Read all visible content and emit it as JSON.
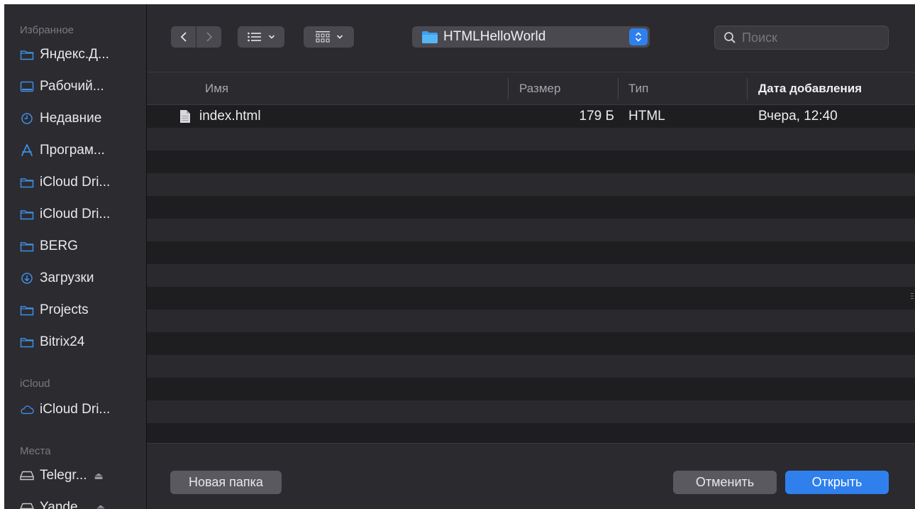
{
  "sidebar": {
    "favorites_title": "Избранное",
    "favorites": [
      {
        "label": "Яндекс.Д...",
        "icon": "folder-icon"
      },
      {
        "label": "Рабочий...",
        "icon": "desktop-icon"
      },
      {
        "label": "Недавние",
        "icon": "clock-icon"
      },
      {
        "label": "Програм...",
        "icon": "apps-icon"
      },
      {
        "label": "iCloud Dri...",
        "icon": "folder-icon"
      },
      {
        "label": "iCloud Dri...",
        "icon": "folder-icon"
      },
      {
        "label": "BERG",
        "icon": "folder-icon"
      },
      {
        "label": "Загрузки",
        "icon": "download-icon"
      },
      {
        "label": "Projects",
        "icon": "folder-icon"
      },
      {
        "label": "Bitrix24",
        "icon": "folder-icon"
      }
    ],
    "icloud_title": "iCloud",
    "icloud": [
      {
        "label": "iCloud Dri...",
        "icon": "cloud-icon"
      }
    ],
    "places_title": "Места",
    "places": [
      {
        "label": "Telegr...",
        "icon": "drive-icon",
        "eject": "⏏"
      },
      {
        "label": "Yande...",
        "icon": "drive-icon",
        "eject": "⏏"
      }
    ]
  },
  "toolbar": {
    "back_icon": "chevron-left-icon",
    "forward_icon": "chevron-right-icon",
    "view_list_icon": "list-view-icon",
    "view_grid_icon": "grid-view-icon",
    "location": "HTMLHelloWorld",
    "search_placeholder": "Поиск"
  },
  "columns": {
    "name": "Имя",
    "size": "Размер",
    "type": "Тип",
    "date": "Дата добавления"
  },
  "files": [
    {
      "name": "index.html",
      "size": "179 Б",
      "type": "HTML",
      "date": "Вчера, 12:40"
    }
  ],
  "buttons": {
    "new_folder": "Новая папка",
    "cancel": "Отменить",
    "open": "Открыть"
  },
  "colors": {
    "accent": "#2f80ed",
    "sidebar_icon": "#3d8fe6"
  }
}
